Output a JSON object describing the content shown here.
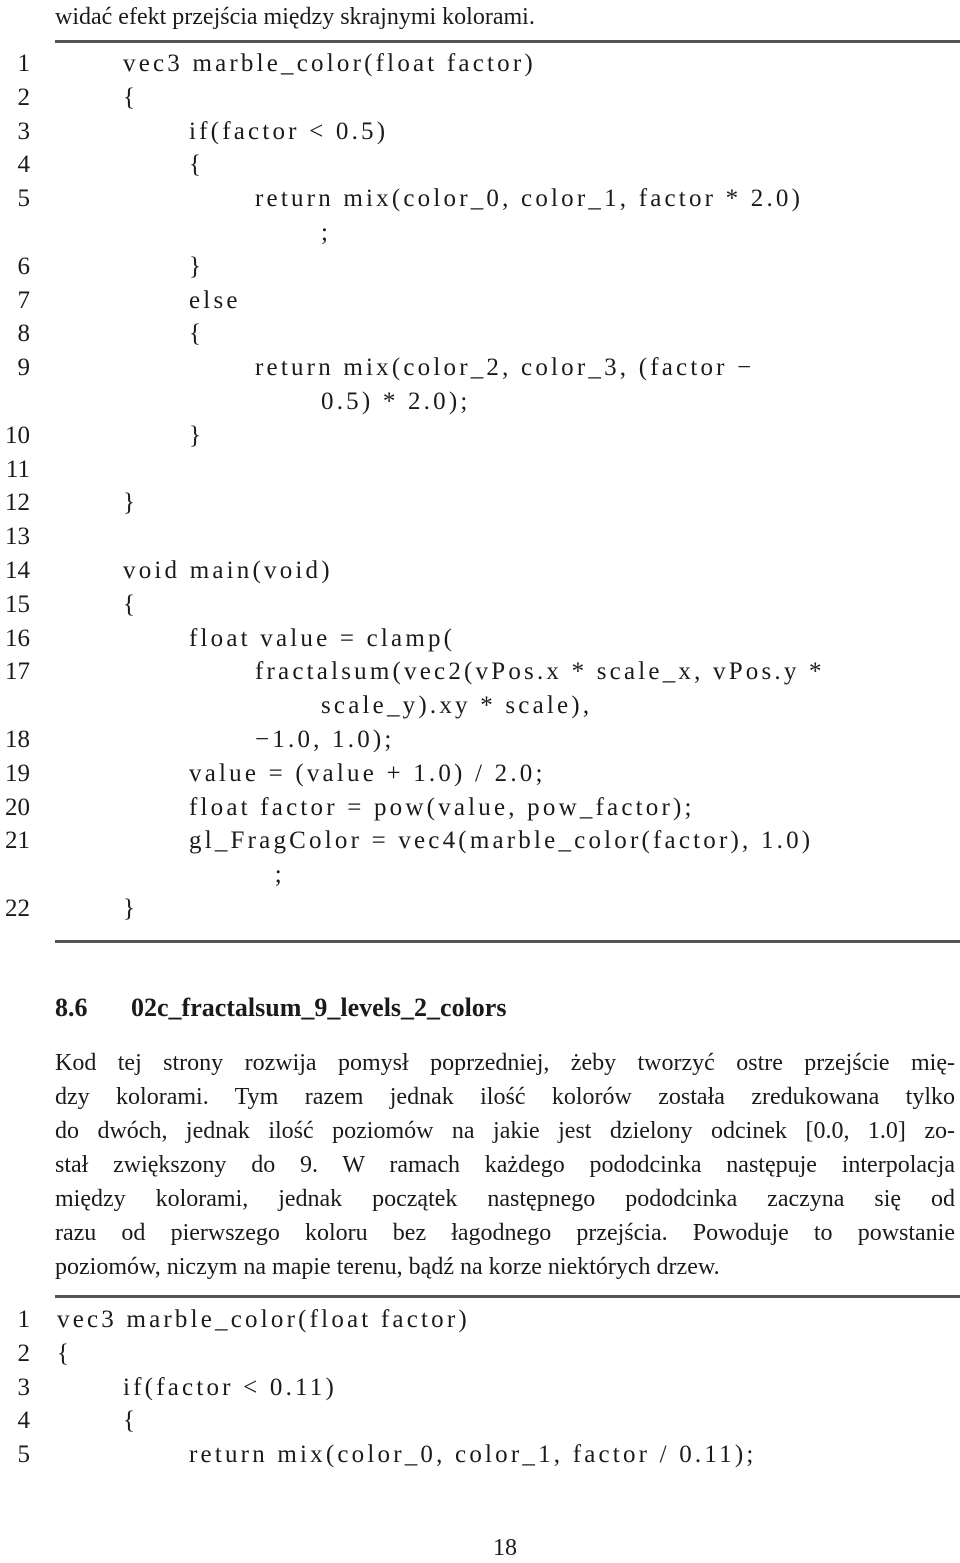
{
  "intro_line": "widać efekt przejścia między skrajnymi kolorami.",
  "listing1": {
    "lines": [
      {
        "n": "1",
        "indent": 0,
        "text": "vec3 marble_color(float factor)"
      },
      {
        "n": "2",
        "indent": 0,
        "text": "{"
      },
      {
        "n": "3",
        "indent": 1,
        "text": "if(factor < 0.5)"
      },
      {
        "n": "4",
        "indent": 1,
        "text": "{"
      },
      {
        "n": "5",
        "indent": 2,
        "text": "return mix(color_0, color_1, factor * 2.0)"
      },
      {
        "n": "",
        "indent": 3,
        "text": ";"
      },
      {
        "n": "6",
        "indent": 1,
        "text": "}"
      },
      {
        "n": "7",
        "indent": 1,
        "text": "else"
      },
      {
        "n": "8",
        "indent": 1,
        "text": "{"
      },
      {
        "n": "9",
        "indent": 2,
        "text": "return mix(color_2, color_3, (factor −"
      },
      {
        "n": "",
        "indent": 3,
        "text": "0.5) * 2.0);"
      },
      {
        "n": "10",
        "indent": 1,
        "text": "}"
      },
      {
        "n": "11",
        "indent": 0,
        "text": ""
      },
      {
        "n": "12",
        "indent": 0,
        "text": "}"
      },
      {
        "n": "13",
        "indent": 0,
        "text": ""
      },
      {
        "n": "14",
        "indent": 0,
        "text": "void main(void)"
      },
      {
        "n": "15",
        "indent": 0,
        "text": "{"
      },
      {
        "n": "16",
        "indent": 1,
        "text": "float value = clamp("
      },
      {
        "n": "17",
        "indent": 2,
        "text": "fractalsum(vec2(vPos.x * scale_x, vPos.y *"
      },
      {
        "n": "",
        "indent": 3,
        "text": "scale_y).xy * scale),"
      },
      {
        "n": "18",
        "indent": 2,
        "text": "−1.0, 1.0);"
      },
      {
        "n": "19",
        "indent": 1,
        "text": "value = (value + 1.0) / 2.0;"
      },
      {
        "n": "20",
        "indent": 1,
        "text": "float factor = pow(value, pow_factor);"
      },
      {
        "n": "21",
        "indent": 1,
        "text": "gl_FragColor = vec4(marble_color(factor), 1.0)"
      },
      {
        "n": "",
        "indent": 2.3,
        "text": ";"
      },
      {
        "n": "22",
        "indent": 0,
        "text": "}"
      }
    ]
  },
  "section": {
    "number": "8.6",
    "title": "02c_fractalsum_9_levels_2_colors"
  },
  "paragraph_lines": [
    "Kod tej strony rozwija pomysł poprzedniej, żeby tworzyć ostre przejście mię-",
    "dzy kolorami. Tym razem jednak ilość kolorów została zredukowana tylko",
    "do dwóch, jednak ilość poziomów na jakie jest dzielony odcinek [0.0, 1.0] zo-",
    "stał zwiększony do 9. W ramach każdego pododcinka następuje interpolacja",
    "między kolorami, jednak początek następnego pododcinka zaczyna się od",
    "razu od pierwszego koloru bez łagodnego przejścia. Powoduje to powstanie",
    "poziomów, niczym na mapie terenu, bądź na korze niektórych drzew."
  ],
  "listing2": {
    "lines": [
      {
        "n": "1",
        "indent": 0,
        "text": "vec3 marble_color(float factor)"
      },
      {
        "n": "2",
        "indent": 0,
        "text": "{"
      },
      {
        "n": "3",
        "indent": 1,
        "text": "if(factor < 0.11)"
      },
      {
        "n": "4",
        "indent": 1,
        "text": "{"
      },
      {
        "n": "5",
        "indent": 2,
        "text": "return mix(color_0, color_1, factor / 0.11);"
      }
    ]
  },
  "page_number": "18"
}
